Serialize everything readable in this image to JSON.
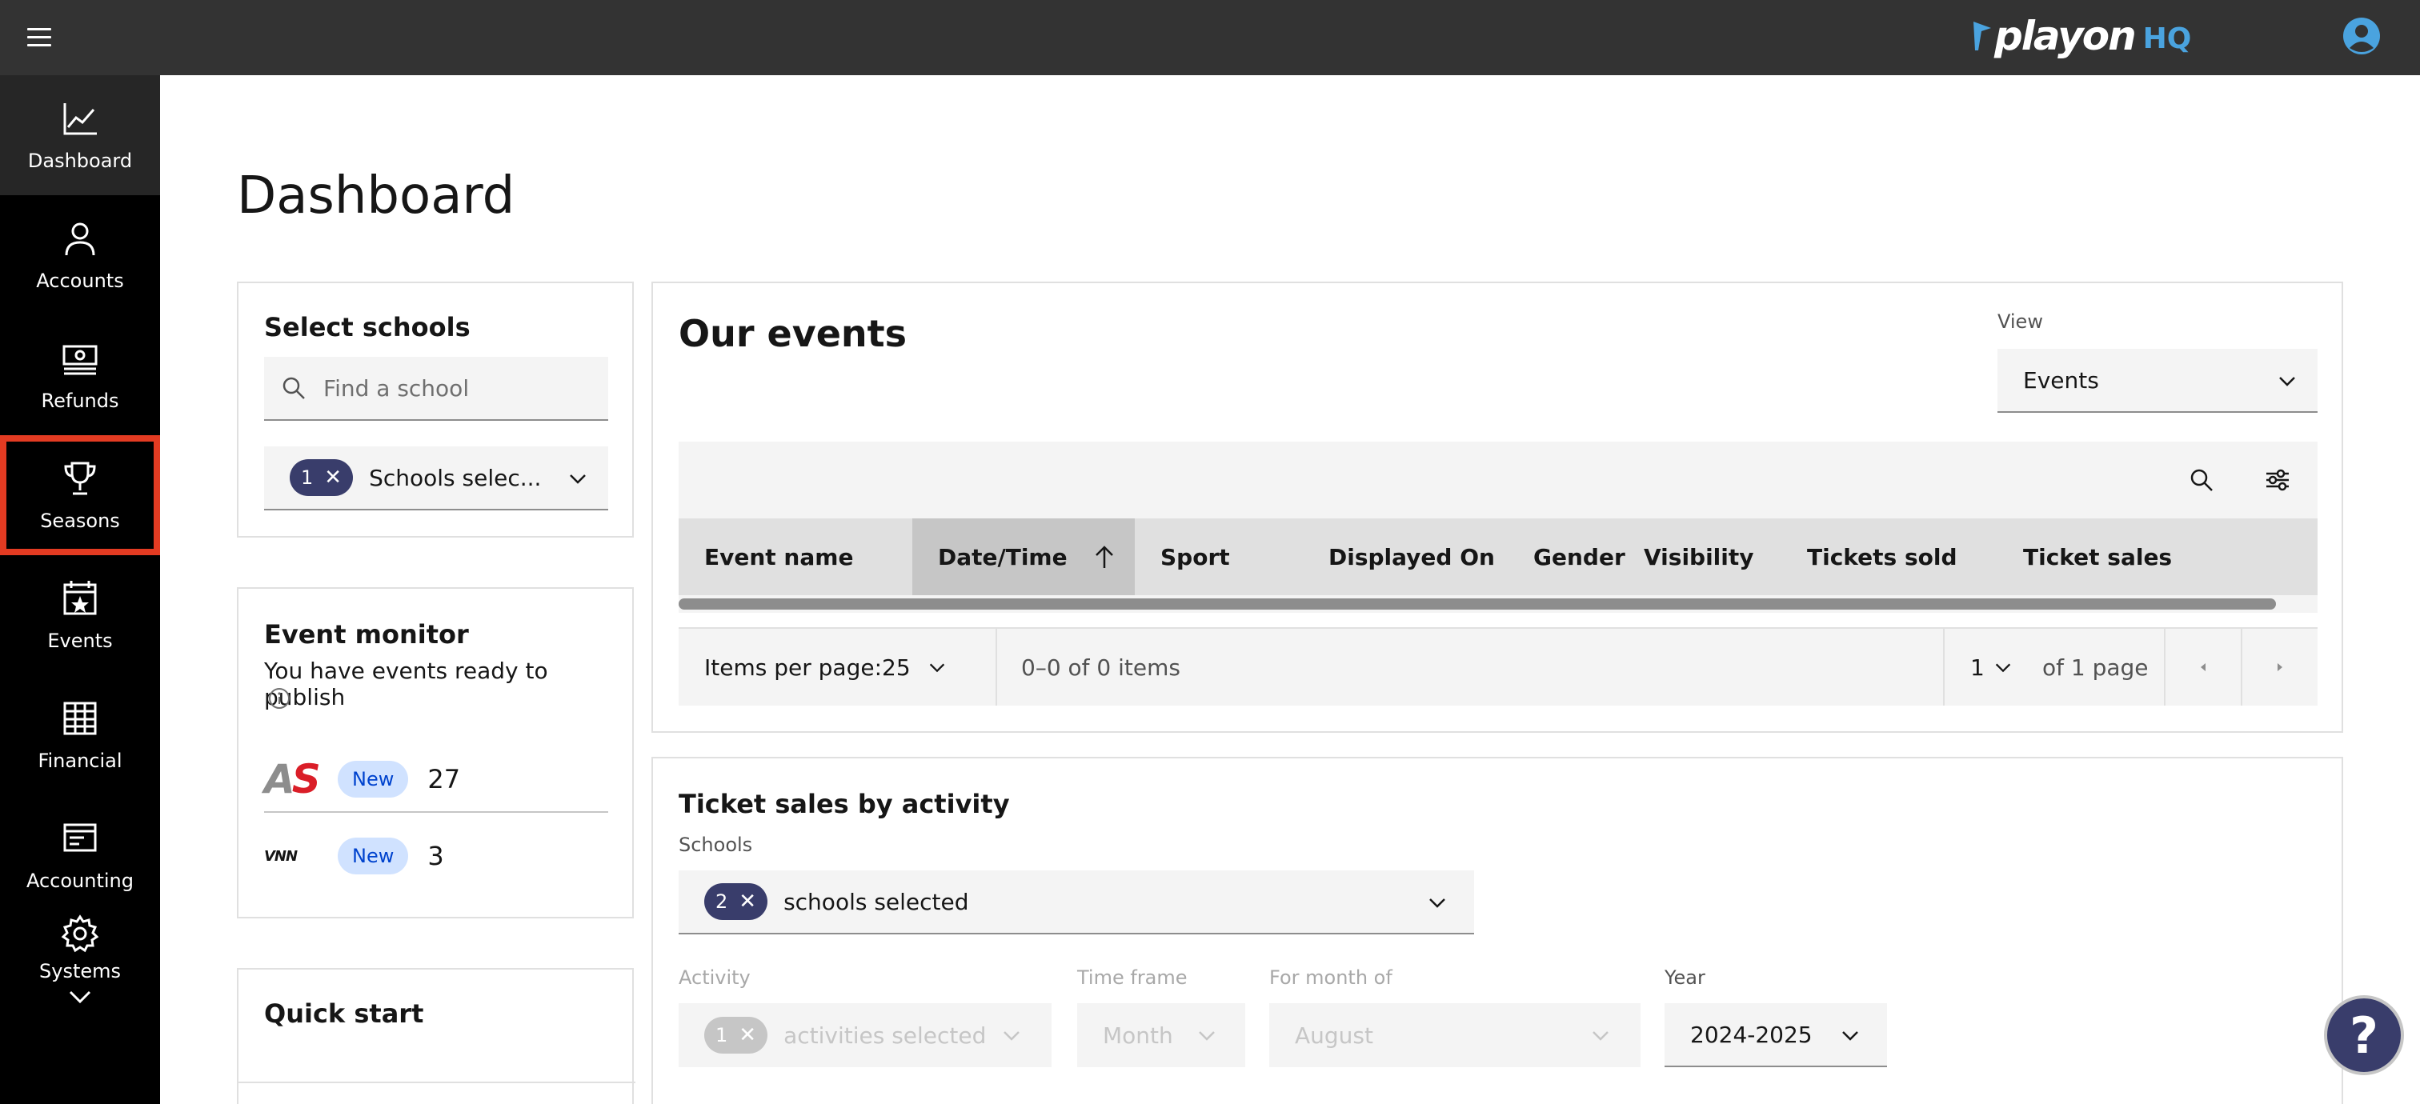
{
  "brand": {
    "name": "playon",
    "suffix": "HQ",
    "accent": "#4aa3df"
  },
  "nav": {
    "items": [
      {
        "label": "Dashboard",
        "icon": "chart-line-icon"
      },
      {
        "label": "Accounts",
        "icon": "user-icon"
      },
      {
        "label": "Refunds",
        "icon": "money-icon"
      },
      {
        "label": "Seasons",
        "icon": "trophy-icon"
      },
      {
        "label": "Events",
        "icon": "calendar-star-icon"
      },
      {
        "label": "Financial",
        "icon": "table-icon"
      },
      {
        "label": "Accounting",
        "icon": "receipt-icon"
      },
      {
        "label": "Systems",
        "icon": "gear-icon"
      }
    ],
    "highlight_color": "#e33b22"
  },
  "page": {
    "title": "Dashboard"
  },
  "select_schools": {
    "title": "Select schools",
    "search_placeholder": "Find a school",
    "tag_count": "1",
    "selected_text": "Schools selec..."
  },
  "event_monitor": {
    "title": "Event monitor",
    "subtitle": "You have events ready to publish",
    "rows": [
      {
        "logo": "AS",
        "badge": "New",
        "count": "27"
      },
      {
        "logo": "VNN",
        "badge": "New",
        "count": "3"
      }
    ]
  },
  "quick_start": {
    "title": "Quick start"
  },
  "our_events": {
    "title": "Our events",
    "view_label": "View",
    "view_value": "Events",
    "columns": [
      "Event name",
      "Date/Time",
      "Sport",
      "Displayed On",
      "Gender",
      "Visibility",
      "Tickets sold",
      "Ticket sales"
    ],
    "pagination": {
      "items_per_page_label": "Items per page:",
      "items_per_page": "25",
      "range": "0–0 of 0 items",
      "page": "1",
      "of_pages": "of 1 page"
    }
  },
  "ticket_sales": {
    "title": "Ticket sales by activity",
    "schools_label": "Schools",
    "schools_tag": "2",
    "schools_selected": "schools selected",
    "activity_label": "Activity",
    "activity_tag": "1",
    "activity_selected": "activities selected",
    "timeframe_label": "Time frame",
    "timeframe_value": "Month",
    "month_label": "For month of",
    "month_value": "August",
    "year_label": "Year",
    "year_value": "2024-2025"
  },
  "help": {
    "symbol": "?"
  }
}
